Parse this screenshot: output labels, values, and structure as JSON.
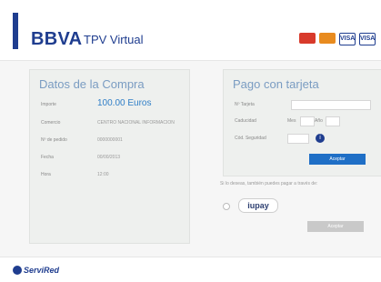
{
  "header": {
    "brand": "BBVA",
    "product": "TPV Virtual",
    "cards": [
      "",
      "",
      "VISA",
      "VISA"
    ]
  },
  "purchase": {
    "title": "Datos de la Compra",
    "rows": [
      {
        "label": "Importe",
        "value": "100.00 Euros"
      },
      {
        "label": "Comercio",
        "value": "CENTRO NACIONAL INFORMACION"
      },
      {
        "label": "Nº de pedido",
        "value": "0000000001"
      },
      {
        "label": "Fecha",
        "value": "00/00/2013"
      },
      {
        "label": "Hora",
        "value": "12:00"
      }
    ]
  },
  "payment": {
    "title": "Pago con tarjeta",
    "card_label": "Nº Tarjeta",
    "expiry_label": "Caducidad",
    "month_label": "Mes",
    "year_label": "Año",
    "cvv_label": "Cód. Seguridad",
    "info_icon": "i",
    "accept_label": "Aceptar"
  },
  "alt_payment": {
    "note": "Si lo deseas, también puedes pagar a través de:",
    "iupay_label": "iupay",
    "accept_label": "Aceptar"
  },
  "footer": {
    "logo": "ServiRed"
  }
}
